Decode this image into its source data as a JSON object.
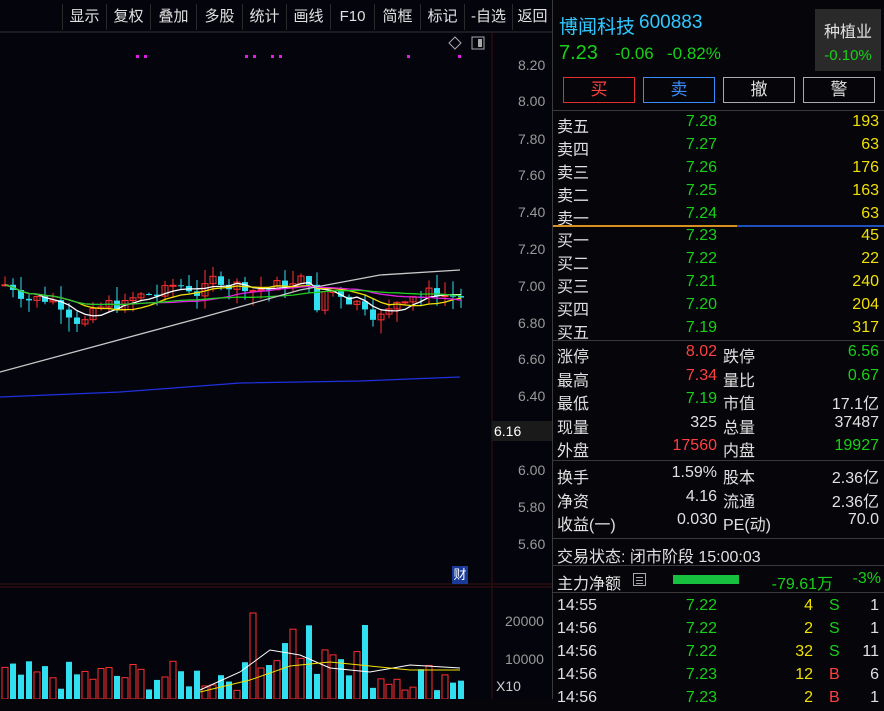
{
  "toolbar": {
    "items": [
      "显示",
      "复权",
      "叠加",
      "多股",
      "统计",
      "画线",
      "F10",
      "简框",
      "标记",
      "-自选",
      "返回"
    ]
  },
  "price_axis": {
    "labels": [
      "8.20",
      "8.00",
      "7.80",
      "7.60",
      "7.40",
      "7.20",
      "7.00",
      "6.80",
      "6.60",
      "6.40",
      "6.00",
      "5.80",
      "5.60"
    ],
    "current_marker": "6.16"
  },
  "volume_axis": {
    "labels": [
      "20000",
      "10000"
    ],
    "unit": "X10"
  },
  "finance_marker": "财",
  "header": {
    "stock_name": "博闻科技",
    "stock_code": "600883",
    "last_price": "7.23",
    "change": "-0.06",
    "change_pct": "-0.82%",
    "sector_name": "种植业",
    "sector_change": "-0.10%"
  },
  "trade_buttons": {
    "buy": "买",
    "sell": "卖",
    "cancel": "撤",
    "alert": "警"
  },
  "asks": [
    {
      "label": "卖五",
      "price": "7.28",
      "volume": "193"
    },
    {
      "label": "卖四",
      "price": "7.27",
      "volume": "63"
    },
    {
      "label": "卖三",
      "price": "7.26",
      "volume": "176"
    },
    {
      "label": "卖二",
      "price": "7.25",
      "volume": "163"
    },
    {
      "label": "卖一",
      "price": "7.24",
      "volume": "63"
    }
  ],
  "bids": [
    {
      "label": "买一",
      "price": "7.23",
      "volume": "45"
    },
    {
      "label": "买二",
      "price": "7.22",
      "volume": "22"
    },
    {
      "label": "买三",
      "price": "7.21",
      "volume": "240"
    },
    {
      "label": "买四",
      "price": "7.20",
      "volume": "204"
    },
    {
      "label": "买五",
      "price": "7.19",
      "volume": "317"
    }
  ],
  "stats": [
    {
      "l1": "涨停",
      "v1": "8.02",
      "l2": "跌停",
      "v2": "6.56"
    },
    {
      "l1": "最高",
      "v1": "7.34",
      "l2": "量比",
      "v2": "0.67"
    },
    {
      "l1": "最低",
      "v1": "7.19",
      "l2": "市值",
      "v2": "17.1亿"
    },
    {
      "l1": "现量",
      "v1": "325",
      "l2": "总量",
      "v2": "37487"
    },
    {
      "l1": "外盘",
      "v1": "17560",
      "l2": "内盘",
      "v2": "19927"
    }
  ],
  "fundamentals": [
    {
      "l1": "换手",
      "v1": "1.59%",
      "l2": "股本",
      "v2": "2.36亿"
    },
    {
      "l1": "净资",
      "v1": "4.16",
      "l2": "流通",
      "v2": "2.36亿"
    },
    {
      "l1": "收益(一)",
      "v1": "0.030",
      "l2": "PE(动)",
      "v2": "70.0"
    }
  ],
  "trading_status": "交易状态: 闭市阶段 15:00:03",
  "main_flow": {
    "label": "主力净额",
    "value": "-79.61万",
    "pct": "-3%"
  },
  "ticks": [
    {
      "time": "14:55",
      "price": "7.22",
      "vol": "4",
      "side": "S",
      "count": "1"
    },
    {
      "time": "14:56",
      "price": "7.22",
      "vol": "2",
      "side": "S",
      "count": "1"
    },
    {
      "time": "14:56",
      "price": "7.22",
      "vol": "32",
      "side": "S",
      "count": "11"
    },
    {
      "time": "14:56",
      "price": "7.23",
      "vol": "12",
      "side": "B",
      "count": "6"
    },
    {
      "time": "14:56",
      "price": "7.23",
      "vol": "2",
      "side": "B",
      "count": "1"
    }
  ],
  "colors": {
    "up": "#ff4040",
    "down": "#18d018",
    "flat": "#e0e0e0",
    "sell_btn": "#3a8cff",
    "buy_btn": "#e03030"
  }
}
